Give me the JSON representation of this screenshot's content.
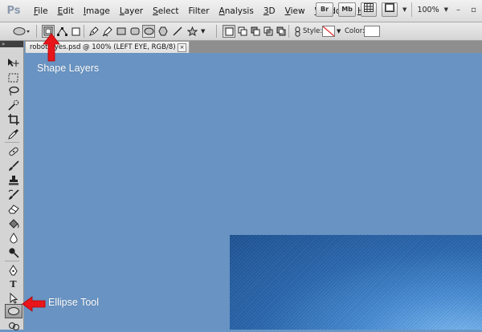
{
  "app": {
    "logo": "Ps"
  },
  "menu": [
    {
      "label": "File",
      "ul": "F",
      "rest": "ile"
    },
    {
      "label": "Edit",
      "ul": "E",
      "rest": "dit"
    },
    {
      "label": "Image",
      "ul": "I",
      "rest": "mage"
    },
    {
      "label": "Layer",
      "ul": "L",
      "rest": "ayer"
    },
    {
      "label": "Select",
      "ul": "S",
      "rest": "elect"
    },
    {
      "label": "Filter",
      "ul": "",
      "rest": "Filter"
    },
    {
      "label": "Analysis",
      "ul": "A",
      "rest": "nalysis"
    },
    {
      "label": "3D",
      "ul": "3",
      "rest": "D"
    },
    {
      "label": "View",
      "ul": "V",
      "rest": "iew"
    },
    {
      "label": "Window",
      "ul": "W",
      "rest": "indow"
    },
    {
      "label": "Help",
      "ul": "H",
      "rest": "elp"
    }
  ],
  "menubar_right": {
    "bridge_label": "Br",
    "minibridge_label": "Mb",
    "zoom": "100%"
  },
  "options": {
    "style_label": "Style:",
    "color_label": "Color:"
  },
  "document": {
    "tab_title": "robot-eyes.psd @ 100% (LEFT EYE, RGB/8) *",
    "close_glyph": "×"
  },
  "annotations": {
    "shape_layers": "Shape Layers",
    "ellipse_tool": "Ellipse Tool"
  },
  "colors": {
    "canvas": "#6893c2",
    "annotation_arrow": "#e8161b",
    "annotation_text": "#ffffff"
  }
}
